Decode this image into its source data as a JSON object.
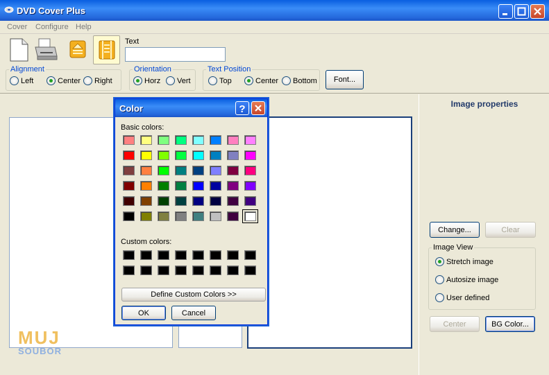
{
  "window": {
    "title": "DVD Cover Plus"
  },
  "menu": [
    "Cover",
    "Configure",
    "Help"
  ],
  "toolbar": {
    "text_label": "Text",
    "text_value": "",
    "font_button": "Font..."
  },
  "alignment": {
    "label": "Alignment",
    "options": [
      "Left",
      "Center",
      "Right"
    ],
    "selected": "Center"
  },
  "orientation": {
    "label": "Orientation",
    "options": [
      "Horz",
      "Vert"
    ],
    "selected": "Horz"
  },
  "text_position": {
    "label": "Text Position",
    "options": [
      "Top",
      "Center",
      "Bottom"
    ],
    "selected": "Center"
  },
  "image_properties": {
    "title": "Image properties",
    "change_button": "Change...",
    "clear_button": "Clear",
    "image_view_label": "Image View",
    "image_view_options": [
      "Stretch image",
      "Autosize image",
      "User defined"
    ],
    "image_view_selected": "Stretch image",
    "center_button": "Center",
    "bg_color_button": "BG Color..."
  },
  "color_dialog": {
    "title": "Color",
    "basic_label": "Basic colors:",
    "custom_label": "Custom colors:",
    "define_button": "Define Custom Colors >>",
    "ok_button": "OK",
    "cancel_button": "Cancel",
    "basic_colors": [
      [
        "#ff8080",
        "#ffff80",
        "#80ff80",
        "#00ff80",
        "#80ffff",
        "#0080ff",
        "#ff80c0",
        "#ff80ff"
      ],
      [
        "#ff0000",
        "#ffff00",
        "#80ff00",
        "#00ff40",
        "#00ffff",
        "#0080c0",
        "#8080c0",
        "#ff00ff"
      ],
      [
        "#804040",
        "#ff8040",
        "#00ff00",
        "#008080",
        "#004080",
        "#8080ff",
        "#800040",
        "#ff0080"
      ],
      [
        "#800000",
        "#ff8000",
        "#008000",
        "#008040",
        "#0000ff",
        "#0000a0",
        "#800080",
        "#8000ff"
      ],
      [
        "#400000",
        "#804000",
        "#004000",
        "#004040",
        "#000080",
        "#000040",
        "#400040",
        "#400080"
      ],
      [
        "#000000",
        "#808000",
        "#808040",
        "#808080",
        "#408080",
        "#c0c0c0",
        "#400040",
        "#ffffff"
      ]
    ],
    "selected_color": "#ffffff",
    "custom_colors": [
      [
        "#000000",
        "#000000",
        "#000000",
        "#000000",
        "#000000",
        "#000000",
        "#000000",
        "#000000"
      ],
      [
        "#000000",
        "#000000",
        "#000000",
        "#000000",
        "#000000",
        "#000000",
        "#000000",
        "#000000"
      ]
    ]
  },
  "watermark": {
    "line1": "MUJ",
    "line2": "SOUBOR"
  }
}
